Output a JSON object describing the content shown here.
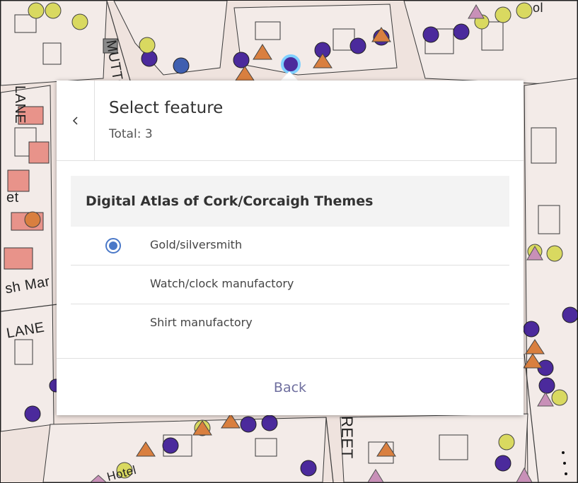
{
  "map": {
    "street_labels": {
      "mutton": "MUTTON",
      "lane_upper": "LANE",
      "et": "et",
      "fish_market": "sh Mar",
      "lane_lower": "LANE",
      "street": "REET",
      "hotel": "Hotel",
      "top_right": "ol"
    },
    "colors": {
      "background": "#efe3de",
      "buildings": "#f3ebe8",
      "outlines": "#3a3a3a",
      "highlight_blocks": "#e8938a",
      "gold_silversmith": "#4b2a9c",
      "watch_clock": "#d9d960",
      "shirt": "#d97f3f",
      "other": "#c890b8"
    }
  },
  "popup": {
    "title": "Select feature",
    "total": "Total: 3",
    "group_title": "Digital Atlas of Cork/Corcaigh Themes",
    "features": [
      {
        "label": "Gold/silversmith",
        "selected": true
      },
      {
        "label": "Watch/clock manufactory",
        "selected": false
      },
      {
        "label": "Shirt manufactory",
        "selected": false
      }
    ],
    "back_label": "Back",
    "accent": "#4a78c8"
  }
}
